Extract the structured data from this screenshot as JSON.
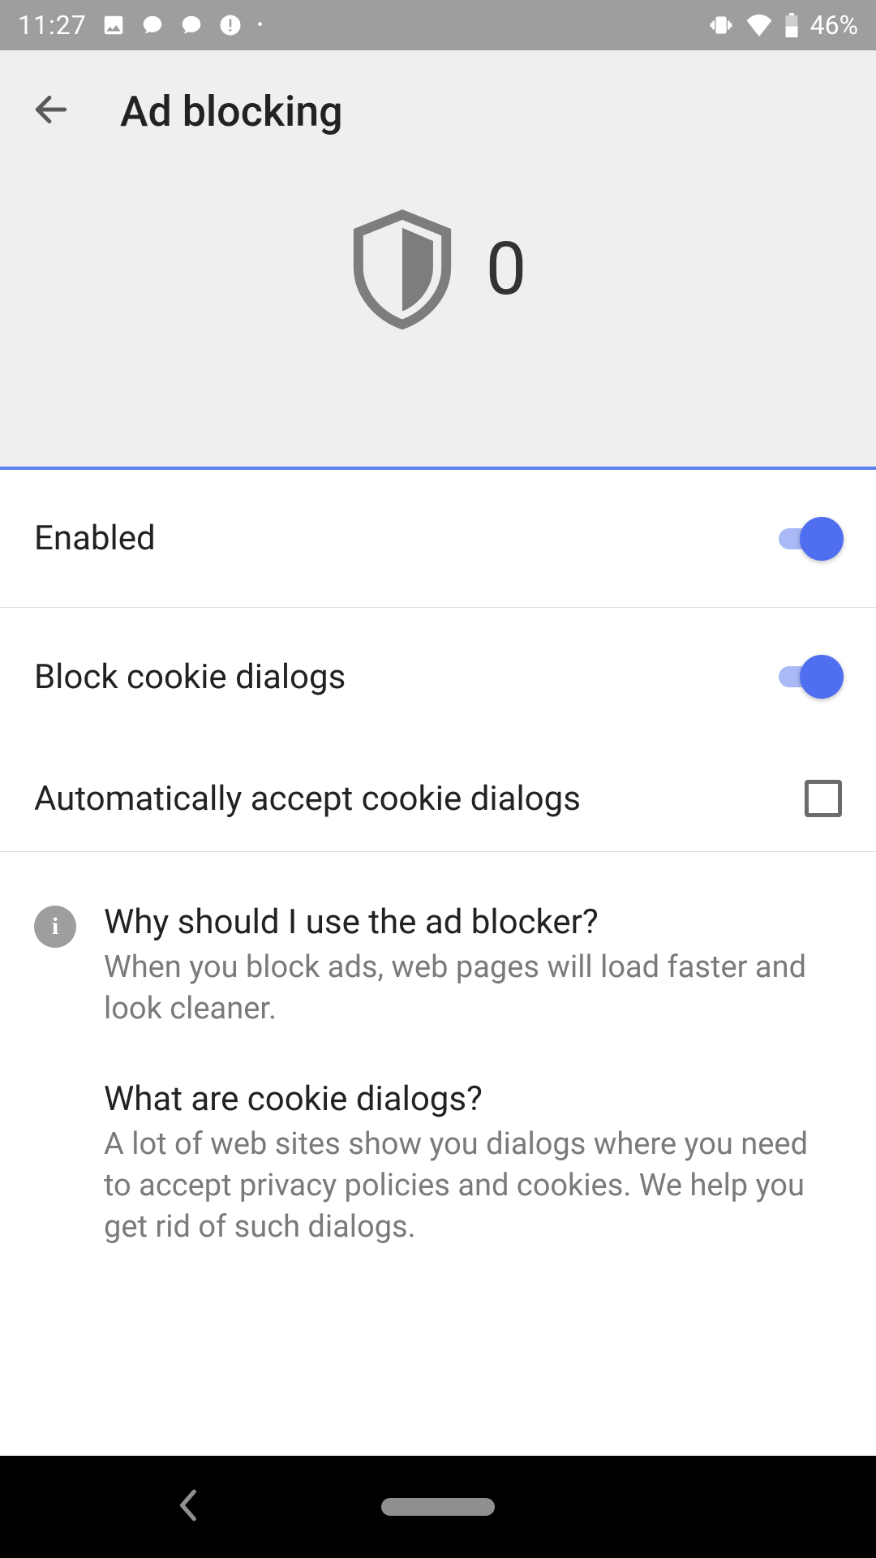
{
  "status": {
    "time": "11:27",
    "battery": "46%"
  },
  "header": {
    "title": "Ad blocking"
  },
  "hero": {
    "count": "0"
  },
  "settings": {
    "enabled_label": "Enabled",
    "block_cookie_label": "Block cookie dialogs",
    "auto_accept_label": "Automatically accept cookie dialogs"
  },
  "info": {
    "q1_title": "Why should I use the ad blocker?",
    "q1_body": "When you block ads, web pages will load faster and look cleaner.",
    "q2_title": "What are cookie dialogs?",
    "q2_body": "A lot of web sites show you dialogs where you need to accept privacy policies and cookies. We help you get rid of such dialogs."
  }
}
